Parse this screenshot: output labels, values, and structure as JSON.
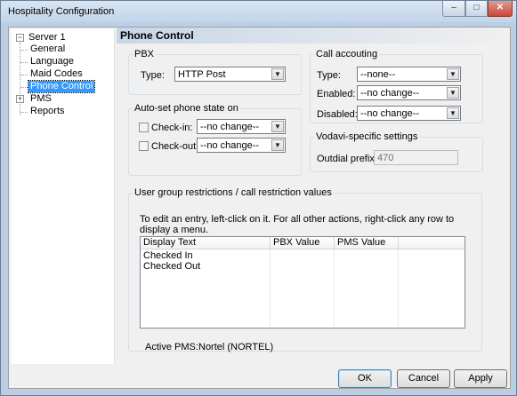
{
  "window": {
    "title": "Hospitality Configuration",
    "min": "–",
    "max": "□",
    "close": "✕"
  },
  "tree": {
    "root": "Server 1",
    "items": [
      "General",
      "Language",
      "Maid Codes",
      "Phone Control",
      "PMS",
      "Reports"
    ],
    "selected": "Phone Control",
    "expand_minus": "−",
    "expand_plus": "+"
  },
  "panel": {
    "title": "Phone Control"
  },
  "pbx": {
    "legend": "PBX",
    "type_label": "Type:",
    "type_value": "HTTP Post"
  },
  "autoset": {
    "legend": "Auto-set phone state on",
    "checkin_label": "Check-in:",
    "checkin_value": "--no change--",
    "checkin_checked": false,
    "checkout_label": "Check-out:",
    "checkout_value": "--no change--",
    "checkout_checked": false
  },
  "call_accounting": {
    "legend": "Call accouting",
    "type_label": "Type:",
    "type_value": "--none--",
    "enabled_label": "Enabled:",
    "enabled_value": "--no change--",
    "disabled_label": "Disabled:",
    "disabled_value": "--no change--"
  },
  "vodavi": {
    "legend": "Vodavi-specific settings",
    "outdial_label": "Outdial prefix:",
    "outdial_value": "470"
  },
  "restrictions": {
    "legend": "User group restrictions / call restriction values",
    "instructions": "To edit an entry, left-click on it.  For all other actions, right-click any row to display a menu.",
    "columns": [
      "Display Text",
      "PBX Value",
      "PMS Value"
    ],
    "rows": [
      [
        "Checked In",
        "",
        ""
      ],
      [
        "Checked Out",
        "",
        ""
      ]
    ],
    "active_pms_label": "Active PMS:",
    "active_pms_value": "Nortel (NORTEL)"
  },
  "buttons": {
    "ok": "OK",
    "cancel": "Cancel",
    "apply": "Apply"
  },
  "icons": {
    "dropdown": "▼"
  }
}
